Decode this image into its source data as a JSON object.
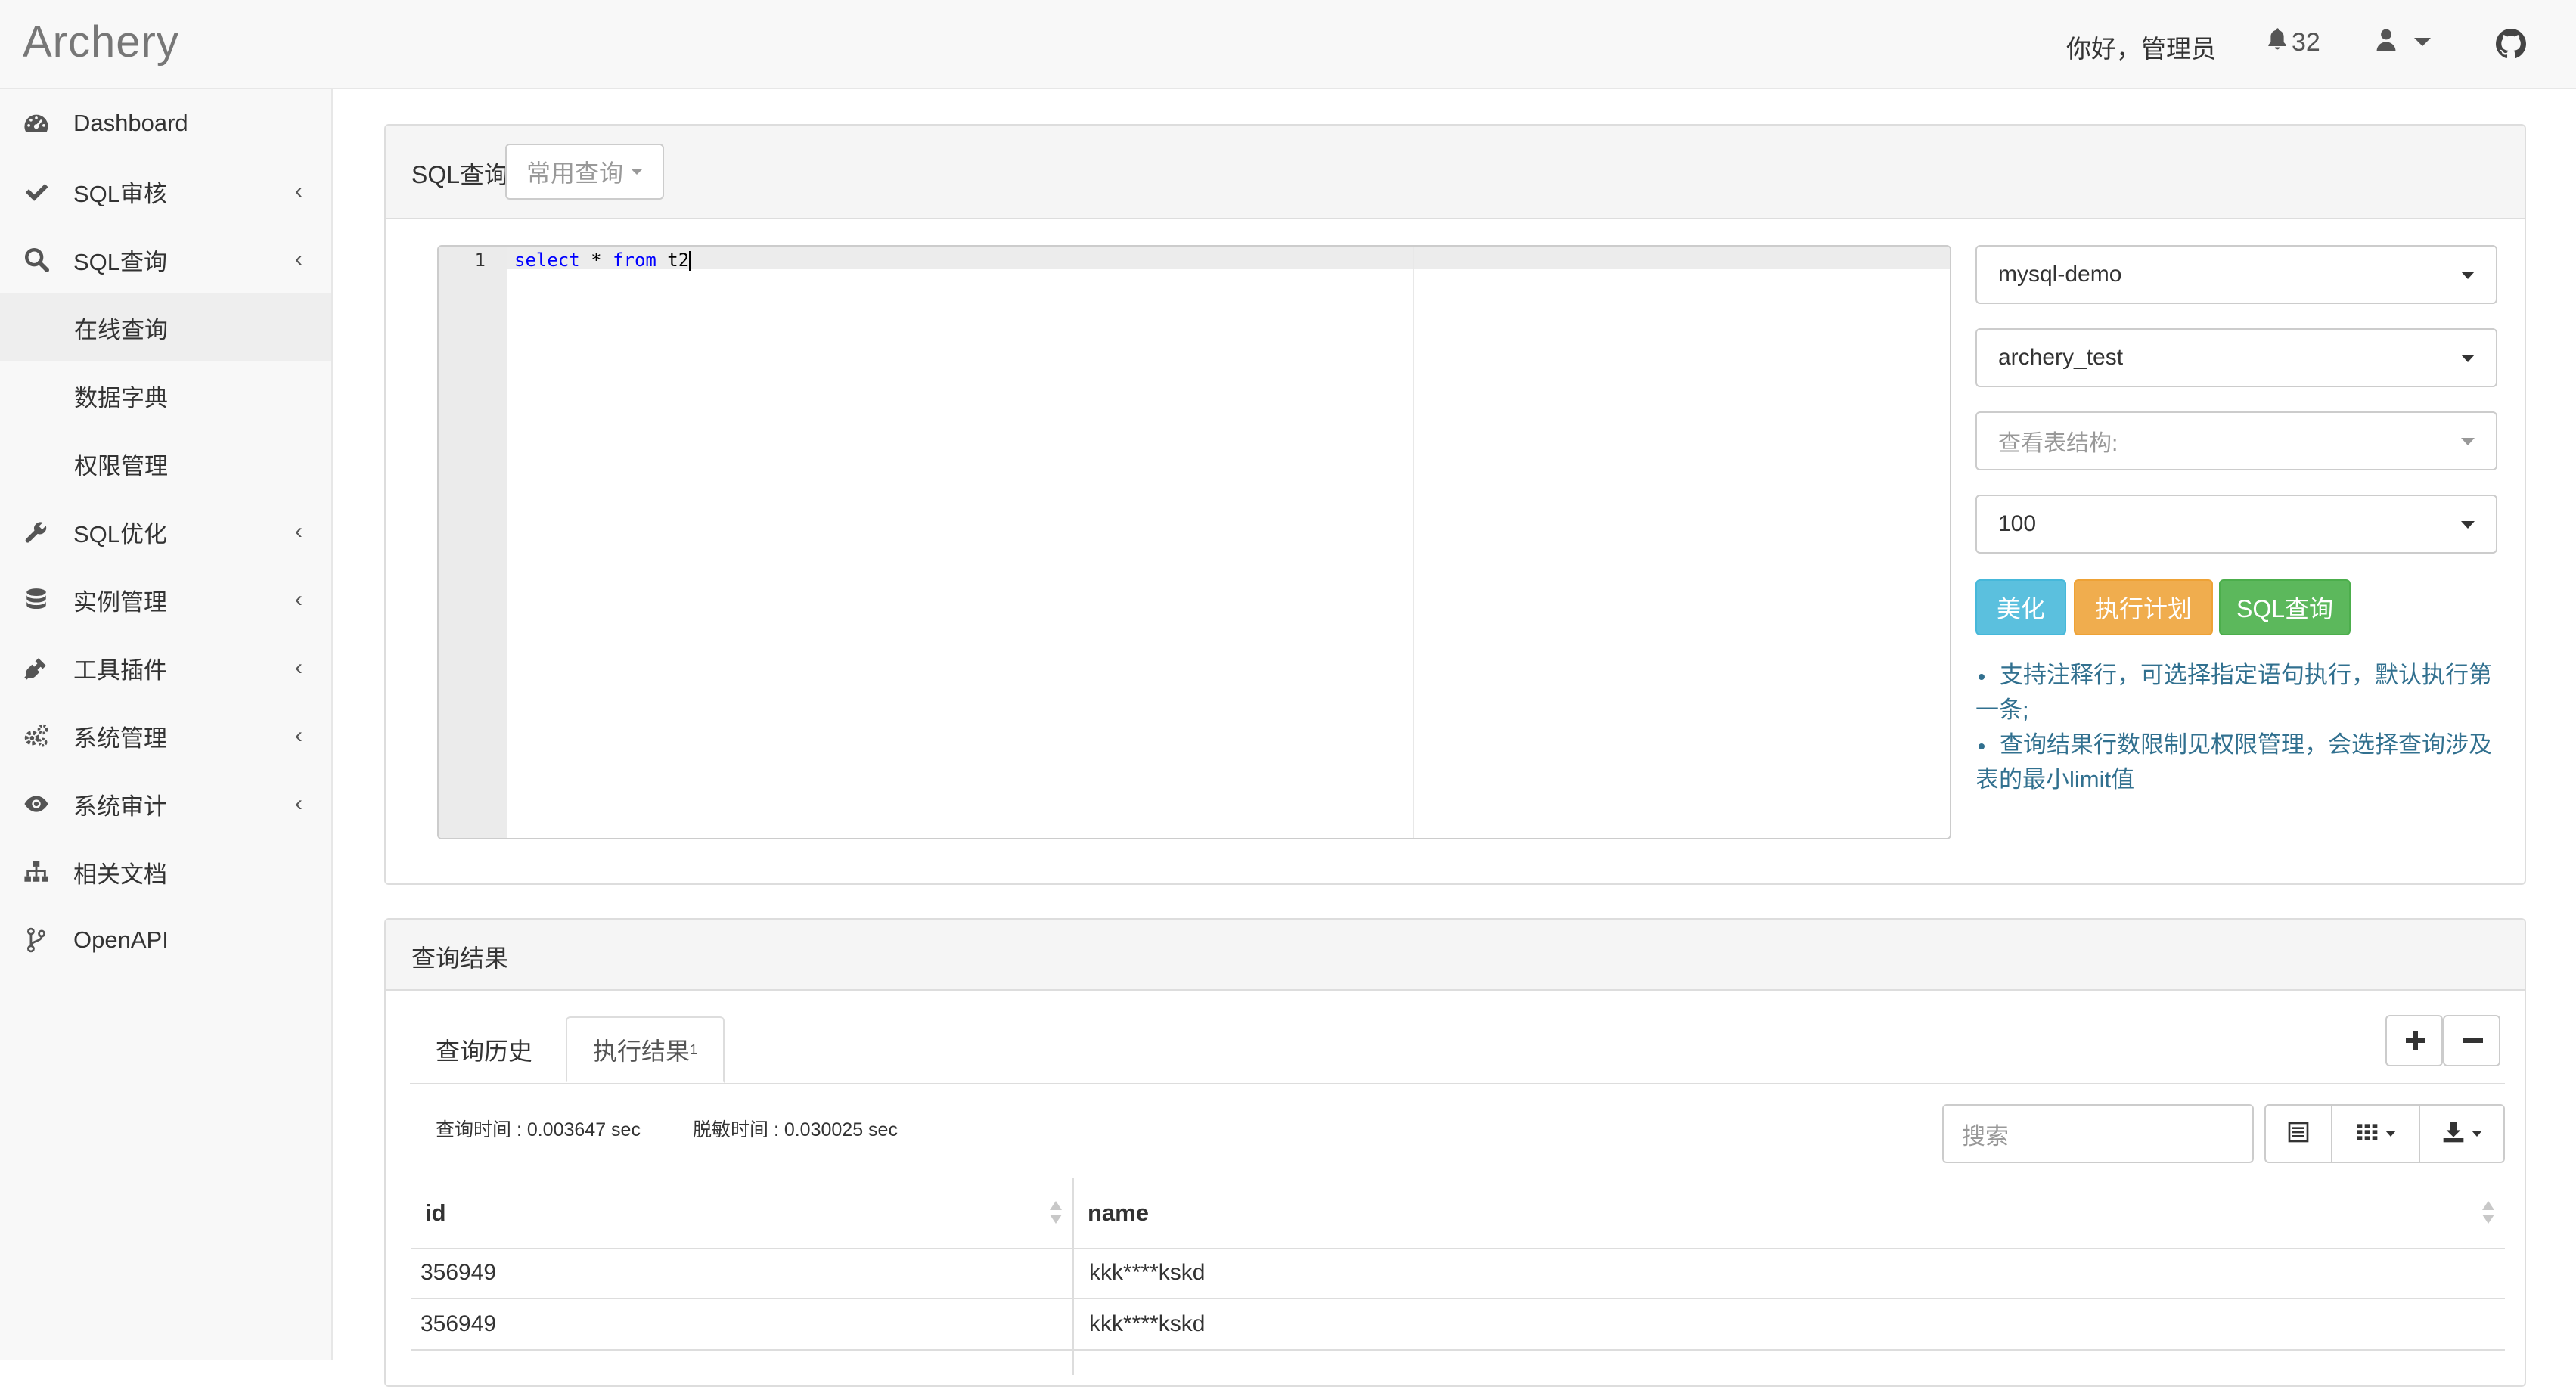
{
  "header": {
    "brand": "Archery",
    "greeting": "你好，管理员",
    "notification_count": "32"
  },
  "sidebar": {
    "items": [
      {
        "label": "Dashboard",
        "icon": "dashboard-icon",
        "has_chevron": false
      },
      {
        "label": "SQL审核",
        "icon": "check-icon",
        "has_chevron": true
      },
      {
        "label": "SQL查询",
        "icon": "search-icon",
        "has_chevron": true
      },
      {
        "label": "在线查询",
        "sub": true,
        "active": true
      },
      {
        "label": "数据字典",
        "sub": true
      },
      {
        "label": "权限管理",
        "sub": true
      },
      {
        "label": "SQL优化",
        "icon": "wrench-icon",
        "has_chevron": true
      },
      {
        "label": "实例管理",
        "icon": "database-icon",
        "has_chevron": true
      },
      {
        "label": "工具插件",
        "icon": "plug-icon",
        "has_chevron": true
      },
      {
        "label": "系统管理",
        "icon": "cogs-icon",
        "has_chevron": true
      },
      {
        "label": "系统审计",
        "icon": "eye-icon",
        "has_chevron": true
      },
      {
        "label": "相关文档",
        "icon": "sitemap-icon",
        "has_chevron": false
      },
      {
        "label": "OpenAPI",
        "icon": "branch-icon",
        "has_chevron": false
      }
    ],
    "chevron": "‹"
  },
  "query_panel": {
    "title": "SQL查询",
    "common_query_label": "常用查询",
    "editor": {
      "line_number": "1",
      "code_keyword_1": "select",
      "code_mid": " * ",
      "code_keyword_2": "from",
      "code_tail": " t2"
    },
    "instance_select": "mysql-demo",
    "database_select": "archery_test",
    "table_select_placeholder": "查看表结构:",
    "limit_select": "100",
    "beautify_button": "美化",
    "explain_button": "执行计划",
    "query_button": "SQL查询",
    "tips": [
      "支持注释行，可选择指定语句执行，默认执行第一条;",
      "查询结果行数限制见权限管理，会选择查询涉及表的最小limit值"
    ]
  },
  "result_panel": {
    "title": "查询结果",
    "tab_history": "查询历史",
    "tab_result": "执行结果",
    "tab_result_index": "1",
    "query_time": "查询时间 : 0.003647 sec",
    "mask_time": "脱敏时间 : 0.030025 sec",
    "search_placeholder": "搜索",
    "columns": [
      "id",
      "name"
    ],
    "rows": [
      [
        "356949",
        "kkk****kskd"
      ],
      [
        "356949",
        "kkk****kskd"
      ]
    ]
  },
  "colors": {
    "info": "#5bc0de",
    "warning": "#f0ad4e",
    "success": "#5cb85c",
    "tip_text": "#31708f"
  }
}
